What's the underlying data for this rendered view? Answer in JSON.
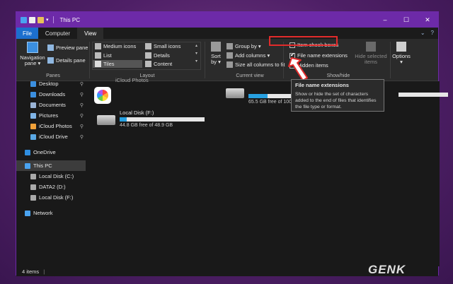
{
  "window": {
    "title": "This PC",
    "controls": {
      "minimize": "–",
      "maximize": "☐",
      "close": "✕"
    }
  },
  "tabs": [
    {
      "label": "File"
    },
    {
      "label": "Computer"
    },
    {
      "label": "View"
    }
  ],
  "ribbon": {
    "panes": {
      "navigation_pane": "Navigation pane ▾",
      "preview_pane": "Preview pane",
      "details_pane": "Details pane",
      "group_label": "Panes"
    },
    "layout": {
      "items": [
        "Medium icons",
        "Small icons",
        "List",
        "Details",
        "Tiles",
        "Content"
      ],
      "selected": "Tiles",
      "group_label": "Layout"
    },
    "current_view": {
      "sort_by": "Sort by ▾",
      "group_by": "Group by ▾",
      "add_columns": "Add columns ▾",
      "size_all_columns": "Size all columns to fit",
      "group_label": "Current view"
    },
    "show_hide": {
      "item_check_boxes": "Item check boxes",
      "file_name_extensions": "File name extensions",
      "hidden_items": "Hidden items",
      "hide_selected_items": "Hide selected items",
      "group_label": "Show/hide",
      "checked": {
        "item_check_boxes": false,
        "file_name_extensions": true,
        "hidden_items": false
      }
    },
    "options": "Options ▾"
  },
  "tooltip": {
    "title": "File name extensions",
    "body": "Show or hide the set of characters added to the end of files that identifies the file type or format."
  },
  "nav": {
    "items": [
      {
        "label": "Desktop",
        "pinned": true,
        "color": "#3b8fe0"
      },
      {
        "label": "Downloads",
        "pinned": true,
        "color": "#3b8fe0"
      },
      {
        "label": "Documents",
        "pinned": true,
        "color": "#9ab4d6"
      },
      {
        "label": "Pictures",
        "pinned": true,
        "color": "#7fb4e6"
      },
      {
        "label": "iCloud Photos",
        "pinned": true,
        "color": "#f2a23a"
      },
      {
        "label": "iCloud Drive",
        "pinned": true,
        "color": "#5aa9e6"
      },
      {
        "label": "OneDrive",
        "pinned": false,
        "color": "#2f8ee0"
      },
      {
        "label": "This PC",
        "pinned": false,
        "color": "#4aa3f0"
      },
      {
        "label": "Local Disk (C:)",
        "pinned": false,
        "color": "#aaa"
      },
      {
        "label": "DATA2 (D:)",
        "pinned": false,
        "color": "#aaa"
      },
      {
        "label": "Local Disk (F:)",
        "pinned": false,
        "color": "#aaa"
      },
      {
        "label": "Network",
        "pinned": false,
        "color": "#4aa3f0"
      }
    ],
    "pin_glyph": "📌"
  },
  "content": {
    "icloud_photos_label": "iCloud Photos",
    "drives": [
      {
        "name": "Local Disk (F:)",
        "free": "44.8 GB free of 48.9 GB",
        "used_fraction": 0.08
      },
      {
        "name": "",
        "free": "65.5 GB free of 100 GB",
        "used_fraction": 0.35
      }
    ]
  },
  "status": {
    "items": "4 items"
  },
  "watermark": "GENK"
}
